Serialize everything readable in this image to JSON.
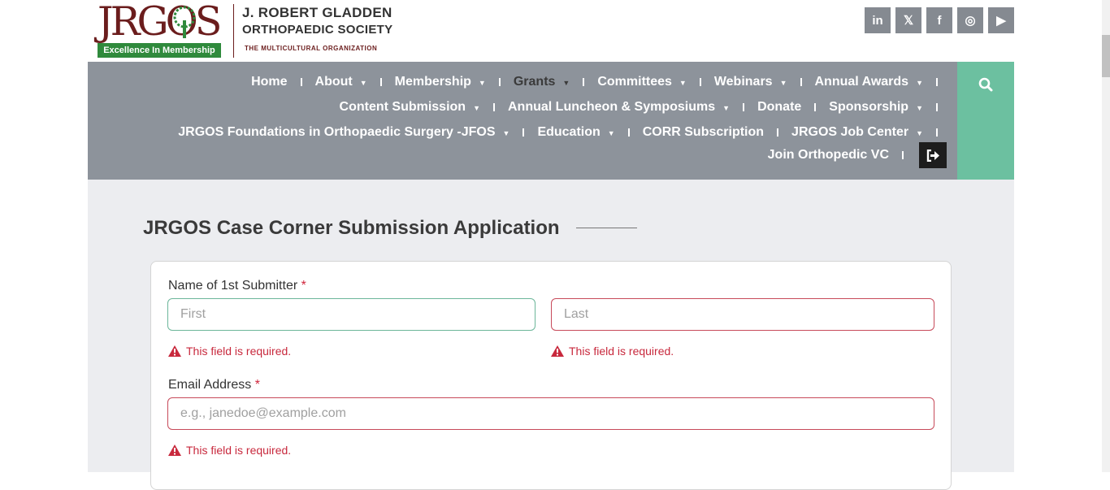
{
  "header": {
    "logo_text": "JRGOS",
    "logo_tagline": "Excellence In Membership",
    "org_name_line1": "J. ROBERT GLADDEN",
    "org_name_line2": "ORTHOPAEDIC SOCIETY",
    "org_subtitle": "THE MULTICULTURAL ORGANIZATION",
    "socials": [
      {
        "icon": "linkedin-icon",
        "glyph": "in"
      },
      {
        "icon": "x-icon",
        "glyph": "𝕏"
      },
      {
        "icon": "facebook-icon",
        "glyph": "f"
      },
      {
        "icon": "instagram-icon",
        "glyph": "◎"
      },
      {
        "icon": "youtube-icon",
        "glyph": "▶"
      }
    ]
  },
  "nav": {
    "row1": [
      "Home",
      "About",
      "Membership",
      "Grants",
      "Committees",
      "Webinars",
      "Annual Awards"
    ],
    "row2": [
      "Content Submission",
      "Annual Luncheon & Symposiums",
      "Donate",
      "Sponsorship"
    ],
    "row3": [
      "JRGOS Foundations in Orthopaedic Surgery -JFOS",
      "Education",
      "CORR Subscription",
      "JRGOS Job Center"
    ],
    "row4": [
      "Join Orthopedic VC"
    ],
    "active": "Grants"
  },
  "form": {
    "title": "JRGOS Case Corner Submission Application",
    "name_label": "Name of 1st Submitter",
    "required_mark": "*",
    "first_placeholder": "First",
    "last_placeholder": "Last",
    "email_label": "Email Address",
    "email_placeholder": "e.g., janedoe@example.com",
    "error_text": "This field is required."
  },
  "colors": {
    "brand_maroon": "#6b1d1d",
    "brand_green": "#2f8a3c",
    "nav_bg": "#8d939b",
    "search_bg": "#6cc0a0",
    "error": "#c8293d"
  }
}
